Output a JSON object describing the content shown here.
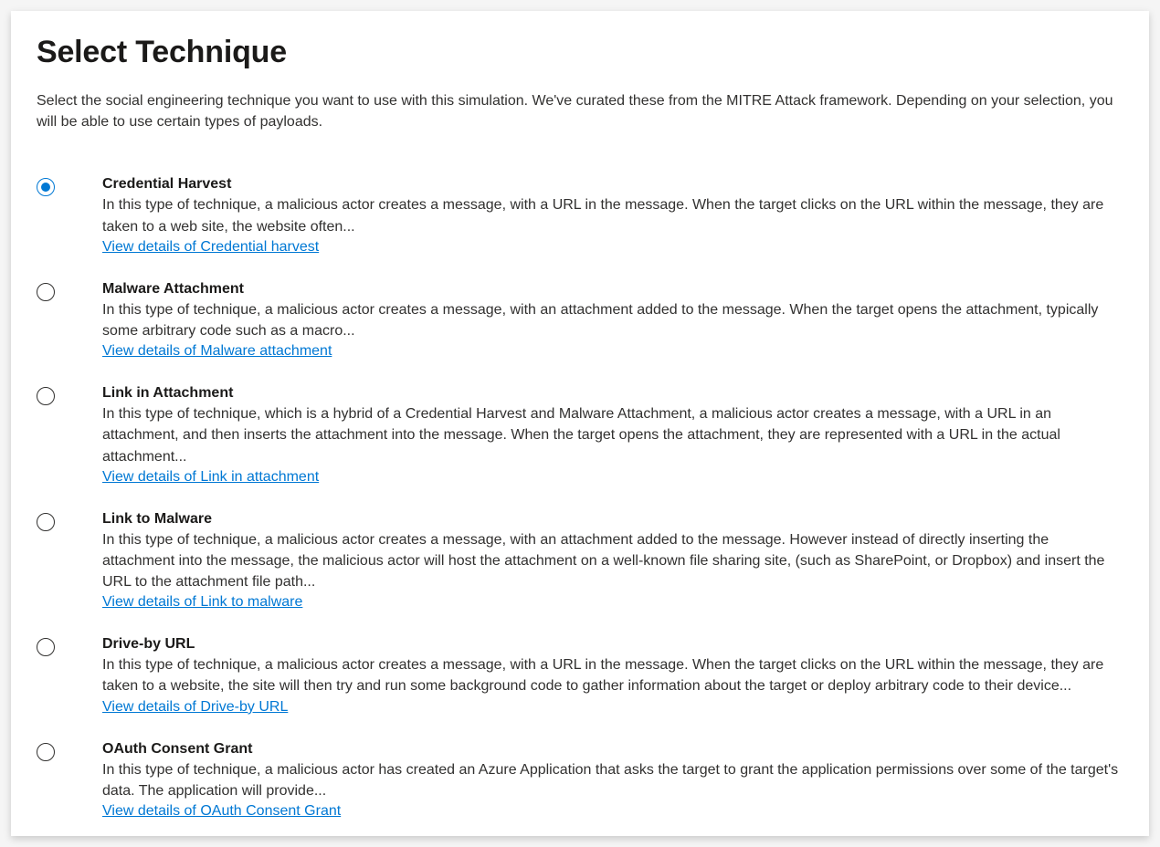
{
  "title": "Select Technique",
  "description": "Select the social engineering technique you want to use with this simulation. We've curated these from the MITRE Attack framework. Depending on your selection, you will be able to use certain types of payloads.",
  "options": [
    {
      "selected": true,
      "title": "Credential Harvest",
      "description": "In this type of technique, a malicious actor creates a message, with a URL in the message. When the target clicks on the URL within the message, they are taken to a web site, the website often...",
      "link": "View details of Credential harvest"
    },
    {
      "selected": false,
      "title": "Malware Attachment",
      "description": "In this type of technique, a malicious actor creates a message, with an attachment added to the message. When the target opens the attachment, typically some arbitrary code such as a macro...",
      "link": "View details of Malware attachment"
    },
    {
      "selected": false,
      "title": "Link in Attachment",
      "description": "In this type of technique, which is a hybrid of a Credential Harvest and Malware Attachment, a malicious actor creates a message, with a URL in an attachment, and then inserts the attachment into the message. When the target opens the attachment, they are represented with a URL in the actual attachment...",
      "link": "View details of Link in attachment"
    },
    {
      "selected": false,
      "title": "Link to Malware",
      "description": "In this type of technique, a malicious actor creates a message, with an attachment added to the message. However instead of directly inserting the attachment into the message, the malicious actor will host the attachment on a well-known file sharing site, (such as SharePoint, or Dropbox) and insert the URL to the attachment file path...",
      "link": "View details of Link to malware"
    },
    {
      "selected": false,
      "title": "Drive-by URL",
      "description": "In this type of technique, a malicious actor creates a message, with a URL in the message. When the target clicks on the URL within the message, they are taken to a website, the site will then try and run some background code to gather information about the target or deploy arbitrary code to their device...",
      "link": "View details of Drive-by URL"
    },
    {
      "selected": false,
      "title": "OAuth Consent Grant",
      "description": "In this type of technique, a malicious actor has created an Azure Application that asks the target to grant the application permissions over some of the target's data. The application will provide...",
      "link": "View details of OAuth Consent Grant"
    }
  ]
}
